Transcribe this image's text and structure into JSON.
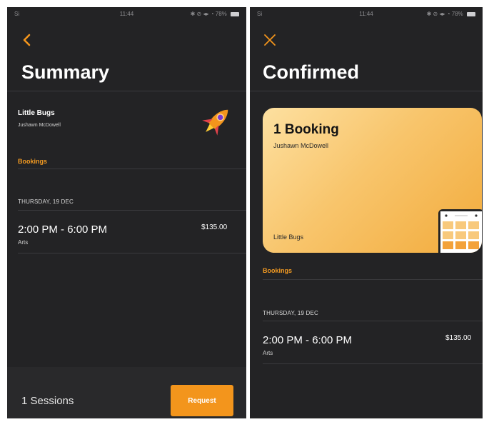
{
  "summary_screen": {
    "status": {
      "carrier": "Si",
      "time": "11:44",
      "indicators": "✱ ⊘ ◂▸ ◔ 78%"
    },
    "back_icon": "chevron-left-icon",
    "title": "Summary",
    "org_name": "Little Bugs",
    "org_person": "Jushawn McDowell",
    "rocket_icon": "rocket-icon",
    "section_label": "Bookings",
    "day": "THURSDAY, 19 DEC",
    "time_range": "2:00 PM - 6:00 PM",
    "activity": "Arts",
    "price": "$135.00",
    "sessions": "1 Sessions",
    "request_label": "Request"
  },
  "confirmed_screen": {
    "status": {
      "carrier": "Si",
      "time": "11:44",
      "indicators": "✱ ⊘ ◂▸ ◔ 78%"
    },
    "close_icon": "close-icon",
    "title": "Confirmed",
    "card": {
      "title": "1 Booking",
      "person": "Jushawn McDowell",
      "org": "Little Bugs",
      "icon": "calendar-icon"
    },
    "section_label": "Bookings",
    "day": "THURSDAY, 19 DEC",
    "time_range": "2:00 PM - 6:00 PM",
    "activity": "Arts",
    "price": "$135.00"
  },
  "colors": {
    "background": "#232325",
    "accent": "#f3951c",
    "card_gradient_end": "#f2ab3c"
  }
}
